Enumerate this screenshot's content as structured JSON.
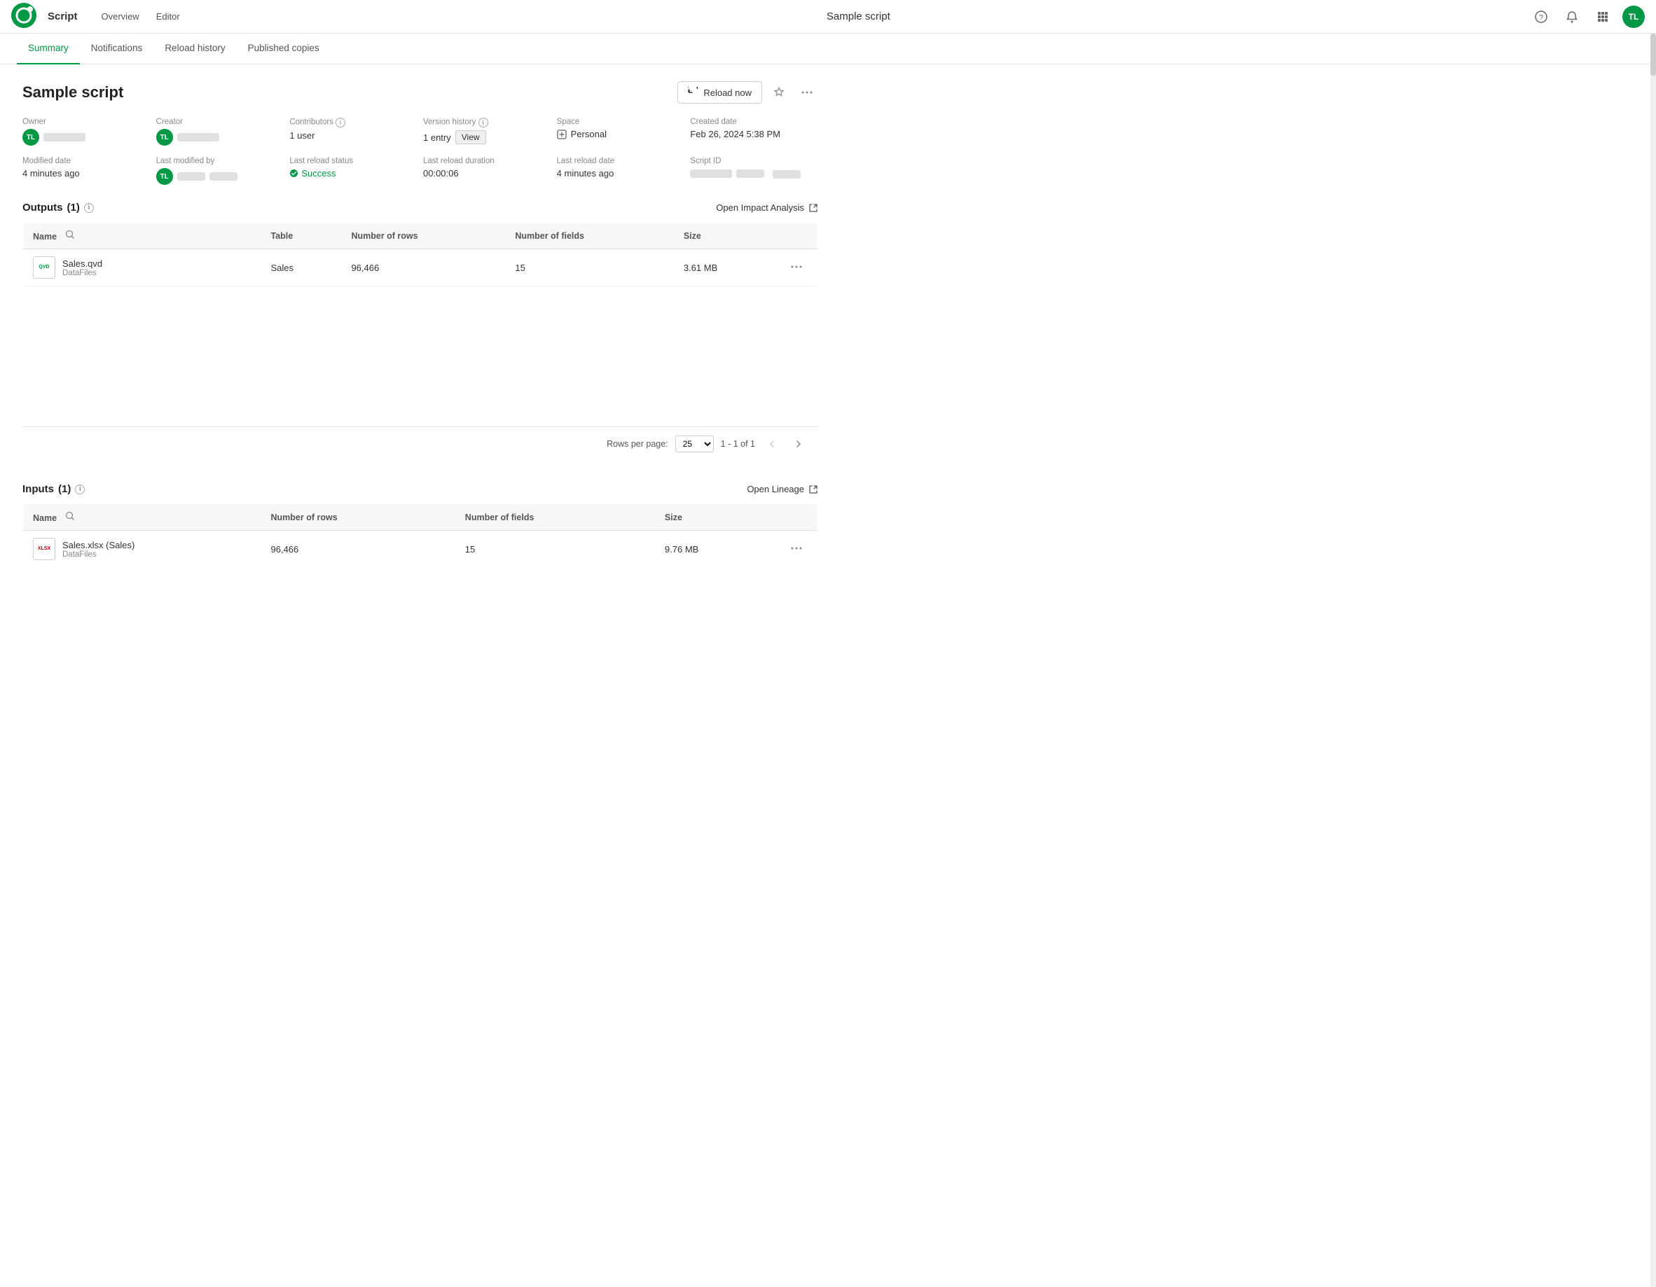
{
  "app": {
    "logo_text": "Qlik",
    "app_name": "Script",
    "nav_links": [
      {
        "label": "Overview",
        "active": false
      },
      {
        "label": "Editor",
        "active": false
      }
    ],
    "center_title": "Sample script",
    "nav_icons": {
      "help": "?",
      "notifications": "🔔",
      "waffle": "⠿",
      "avatar": "TL"
    }
  },
  "tabs": [
    {
      "label": "Summary",
      "active": true
    },
    {
      "label": "Notifications",
      "active": false
    },
    {
      "label": "Reload history",
      "active": false
    },
    {
      "label": "Published copies",
      "active": false
    }
  ],
  "page": {
    "title": "Sample script",
    "reload_btn": "Reload now",
    "more_label": "⋯"
  },
  "meta": {
    "owner_label": "Owner",
    "creator_label": "Creator",
    "contributors_label": "Contributors",
    "contributors_value": "1 user",
    "version_history_label": "Version history",
    "version_history_value": "1 entry",
    "version_view_btn": "View",
    "space_label": "Space",
    "space_value": "Personal",
    "created_date_label": "Created date",
    "created_date_value": "Feb 26, 2024 5:38 PM",
    "modified_date_label": "Modified date",
    "modified_date_value": "4 minutes ago",
    "last_modified_by_label": "Last modified by",
    "last_reload_status_label": "Last reload status",
    "last_reload_status_value": "Success",
    "last_reload_duration_label": "Last reload duration",
    "last_reload_duration_value": "00:00:06",
    "last_reload_date_label": "Last reload date",
    "last_reload_date_value": "4 minutes ago",
    "script_id_label": "Script ID"
  },
  "outputs": {
    "section_title": "Outputs",
    "count": "(1)",
    "action_label": "Open Impact Analysis",
    "table_headers": {
      "name": "Name",
      "table": "Table",
      "num_rows": "Number of rows",
      "num_fields": "Number of fields",
      "size": "Size"
    },
    "rows": [
      {
        "file_name": "Sales.qvd",
        "file_sub": "DataFiles",
        "file_type": "qvd",
        "table": "Sales",
        "num_rows": "96,466",
        "num_fields": "15",
        "size": "3.61 MB"
      }
    ],
    "pagination": {
      "rows_per_page_label": "Rows per page:",
      "rows_per_page_value": "25",
      "page_info": "1 - 1 of 1"
    }
  },
  "inputs": {
    "section_title": "Inputs",
    "count": "(1)",
    "action_label": "Open Lineage",
    "table_headers": {
      "name": "Name",
      "num_rows": "Number of rows",
      "num_fields": "Number of fields",
      "size": "Size"
    },
    "rows": [
      {
        "file_name": "Sales.xlsx (Sales)",
        "file_sub": "DataFiles",
        "file_type": "xlsx",
        "num_rows": "96,466",
        "num_fields": "15",
        "size": "9.76 MB"
      }
    ]
  }
}
